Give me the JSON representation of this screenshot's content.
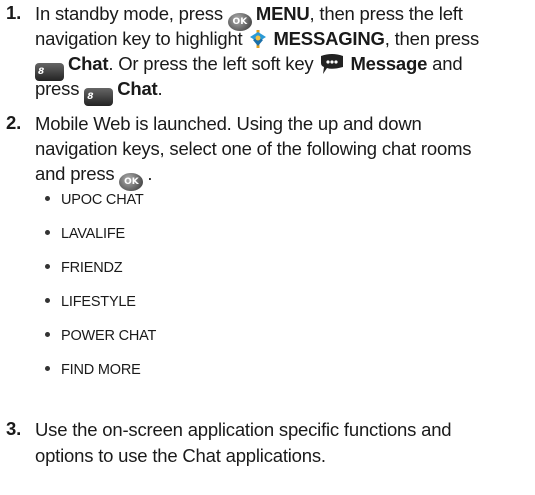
{
  "steps": [
    {
      "number": "1.",
      "lines": {
        "l1_a": "In standby mode, press",
        "l1_ok_icon": "OK",
        "l1_b": "MENU",
        "l1_c": ", then press the left",
        "l2_a": "navigation key to highlight",
        "l2_b": "MESSAGING",
        "l2_c": ", then press",
        "l3_icon": "8",
        "l3_a": "Chat",
        "l3_b": ".  Or press the left soft key",
        "l3_c": "Message",
        "l3_d": " and",
        "l4_a": "press",
        "l4_icon": "8",
        "l4_b": "Chat",
        "l4_c": "."
      }
    },
    {
      "number": "2.",
      "lines": {
        "l1": "Mobile Web is launched. Using the up and down",
        "l2": "navigation keys, select one of the following chat rooms",
        "l3_a": "and press",
        "l3_icon": "OK",
        "l3_b": "."
      }
    },
    {
      "number": "3.",
      "lines": {
        "l1": "Use the on-screen application specific functions and",
        "l2": "options to use the Chat applications."
      }
    }
  ],
  "chat_rooms": [
    "UPOC CHAT",
    "LAVALIFE",
    "FRIENDZ",
    "LIFESTYLE",
    "POWER CHAT",
    "FIND MORE"
  ],
  "icons": {
    "ok": "ok-key-icon",
    "messaging": "messaging-icon",
    "chat": "chat-key-icon",
    "message": "message-softkey-icon"
  },
  "colors": {
    "messaging_icon_main": "#2a9ad6",
    "messaging_icon_accent": "#e0a020",
    "text": "#1a1a1a"
  }
}
